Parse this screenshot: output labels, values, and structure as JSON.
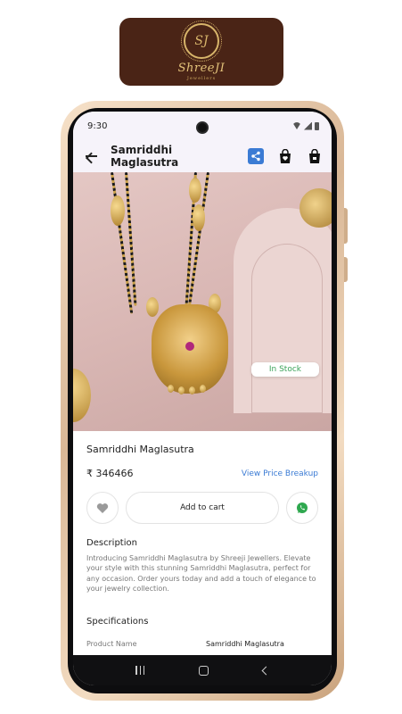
{
  "logo": {
    "name": "ShreeJI",
    "sub": "Jewellers",
    "mark": "SJ"
  },
  "status_bar": {
    "time": "9:30"
  },
  "app_bar": {
    "title": "Samriddhi Maglasutra"
  },
  "product": {
    "stock_status": "In Stock",
    "name": "Samriddhi Maglasutra",
    "price": "₹ 346466",
    "price_breakup_link": "View Price Breakup",
    "add_to_cart_label": "Add to cart"
  },
  "description": {
    "title": "Description",
    "text": "Introducing Samriddhi Maglasutra by Shreeji Jewellers. Elevate your style with this stunning Samriddhi Maglasutra, perfect for any occasion. Order yours today and add a touch of elegance to your jewelry collection."
  },
  "specifications": {
    "title": "Specifications",
    "rows": [
      {
        "label": "Product Name",
        "value": "Samriddhi Maglasutra"
      }
    ]
  },
  "colors": {
    "accent": "#3b7bd4",
    "stock_green": "#3ba35a",
    "logo_bg": "#4a2416",
    "gold": "#d7b46a"
  },
  "icons": [
    "back-arrow-icon",
    "share-icon",
    "wishlist-bag-icon",
    "shopping-bag-icon",
    "heart-icon",
    "whatsapp-icon"
  ]
}
